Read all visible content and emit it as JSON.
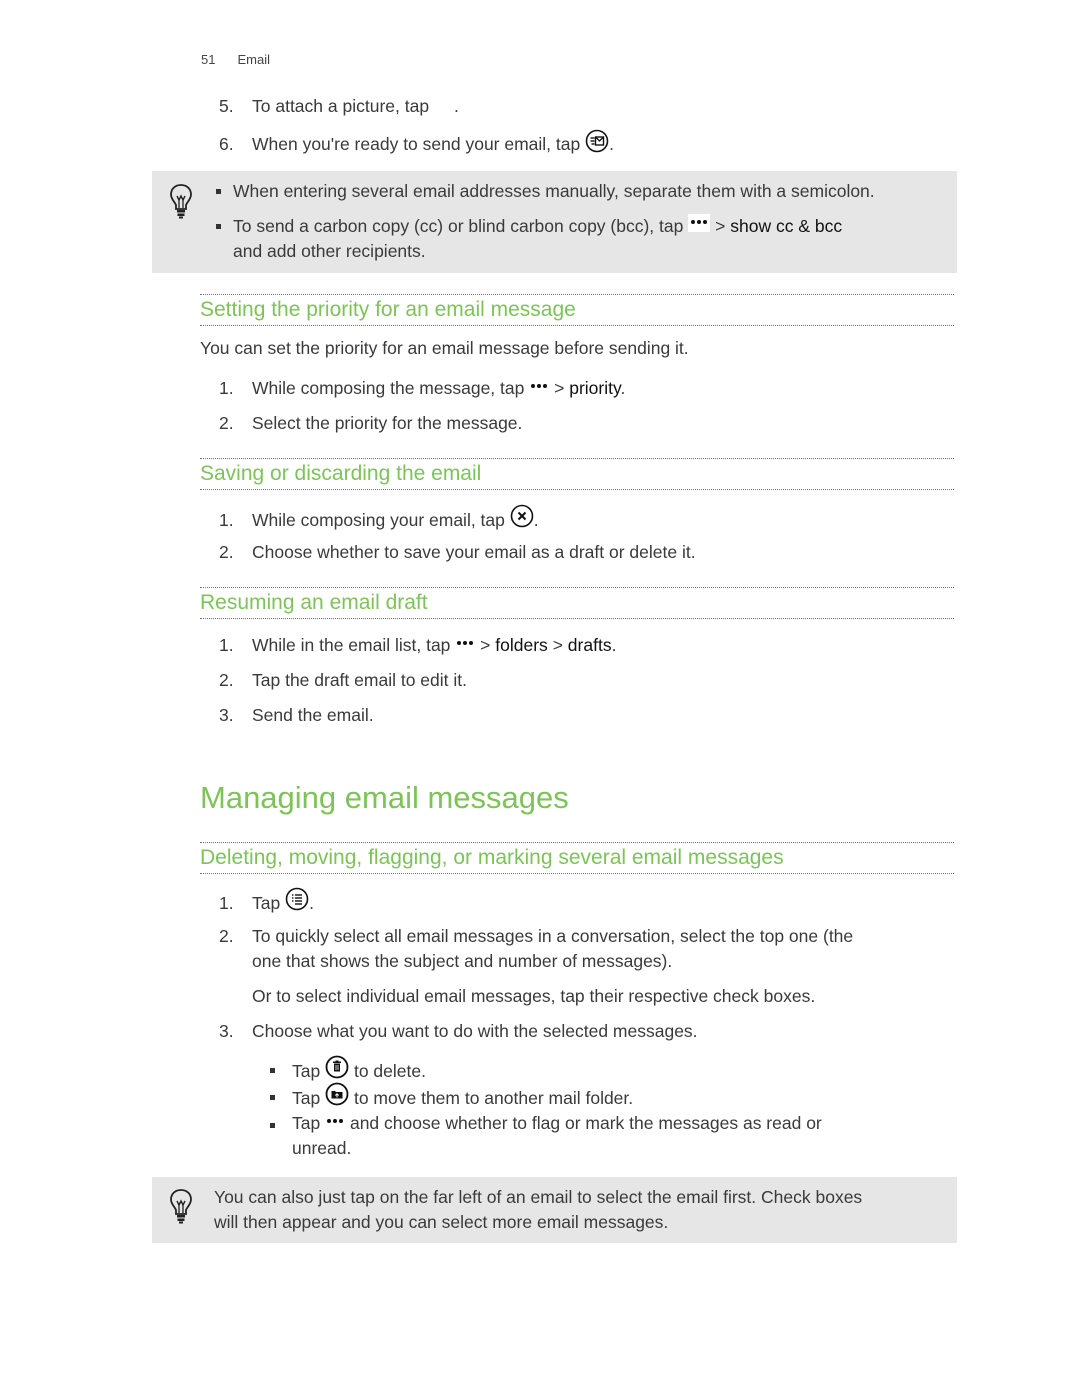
{
  "header": {
    "page_number": "51",
    "section": "Email"
  },
  "intro_steps": [
    {
      "num": "5.",
      "text_before": "To attach a picture, tap",
      "icon": "attach-picture-icon",
      "text_after": "."
    },
    {
      "num": "6.",
      "text_before": "When you're ready to send your email, tap",
      "icon": "send-icon",
      "text_after": "."
    }
  ],
  "tip1": {
    "icon": "lightbulb-icon",
    "bullets": [
      {
        "text": "When entering several email addresses manually, separate them with a semicolon."
      },
      {
        "text_before": "To send a carbon copy (cc) or blind carbon copy (bcc), tap",
        "icon": "more-icon",
        "text_after": ">",
        "bold": "show cc & bcc",
        "line2": "and add other recipients."
      }
    ]
  },
  "section_priority": {
    "heading": "Setting the priority for an email message",
    "intro": "You can set the priority for an email message before sending it.",
    "steps": [
      {
        "num": "1.",
        "text_before": "While composing the message, tap",
        "icon": "more-icon",
        "sep": ">",
        "bold": "priority",
        "text_after": "."
      },
      {
        "num": "2.",
        "text": "Select the priority for the message."
      }
    ]
  },
  "section_saving": {
    "heading": "Saving or discarding the email",
    "steps": [
      {
        "num": "1.",
        "text_before": "While composing your email, tap",
        "icon": "close-circle-icon",
        "text_after": "."
      },
      {
        "num": "2.",
        "text": "Choose whether to save your email as a draft or delete it."
      }
    ]
  },
  "section_resuming": {
    "heading": "Resuming an email draft",
    "steps": [
      {
        "num": "1.",
        "text_before": "While in the email list, tap",
        "icon": "more-icon",
        "sep1": ">",
        "bold1": "folders",
        "sep2": ">",
        "bold2": "drafts",
        "text_after": "."
      },
      {
        "num": "2.",
        "text": "Tap the draft email to edit it."
      },
      {
        "num": "3.",
        "text": "Send the email."
      }
    ]
  },
  "chapter": {
    "title": "Managing email messages"
  },
  "section_deleting": {
    "heading": "Deleting, moving, flagging, or marking several email messages",
    "steps": [
      {
        "num": "1.",
        "text_before": "Tap",
        "icon": "select-list-icon",
        "text_after": "."
      },
      {
        "num": "2.",
        "line1": "To quickly select all email messages in a conversation, select the top one (the",
        "line2": "one that shows the subject and number of messages).",
        "extra": "Or to select individual email messages, tap their respective check boxes."
      },
      {
        "num": "3.",
        "text": "Choose what you want to do with the selected messages."
      }
    ],
    "sub_bullets": [
      {
        "before": "Tap",
        "icon": "trash-icon",
        "after": "to delete."
      },
      {
        "before": "Tap",
        "icon": "move-folder-icon",
        "after": "to move them to another mail folder."
      },
      {
        "before": "Tap",
        "icon": "more-icon",
        "after": "and choose whether to flag or mark the messages as read or",
        "line2": "unread."
      }
    ]
  },
  "tip2": {
    "icon": "lightbulb-icon",
    "line1": "You can also just tap on the far left of an email to select the email first. Check boxes",
    "line2": "will then appear and you can select more email messages."
  },
  "colors": {
    "heading_green": "#7dc35a",
    "tip_background": "#e6e6e6",
    "body_text": "#3a3a3a"
  }
}
